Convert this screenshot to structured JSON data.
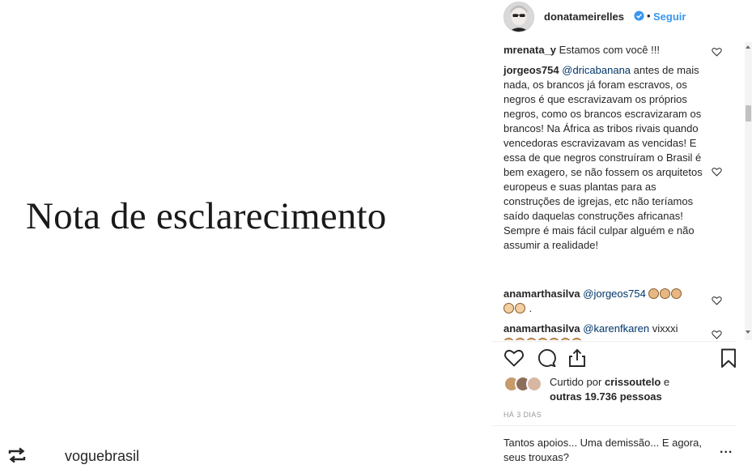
{
  "media": {
    "title": "Nota de esclarecimento",
    "repost_user": "voguebrasil"
  },
  "header": {
    "username": "donatameirelles",
    "separator": "•",
    "follow_label": "Seguir"
  },
  "comments": [
    {
      "user": "mrenata_y",
      "text": "Estamos com você !!!"
    },
    {
      "user": "jorgeos754",
      "mention": "@dricabanana",
      "text": "antes de mais nada, os brancos já foram escravos, os negros é que escravizavam os próprios negros, como os brancos escravizaram os brancos! Na África as tribos rivais quando vencedoras escravizavam as vencidas! E essa de que negros construíram o Brasil é bem exagero, se não fossem os arquitetos europeus e suas plantas para as construções de igrejas, etc não teríamos saído daquelas construções africanas! Sempre é mais fácil culpar alguém e não assumir a realidade!"
    },
    {
      "user": "anamarthasilva",
      "mention": "@jorgeos754",
      "text": "."
    },
    {
      "user": "anamarthasilva",
      "mention": "@karenfkaren",
      "text": "vixxxi"
    }
  ],
  "likes": {
    "prefix": "Curtido por",
    "user": "crissoutelo",
    "conj": "e",
    "others": "outras 19.736 pessoas"
  },
  "date": "HÁ 3 DIAS",
  "add_comment": "Tantos apoios... Uma demissão... E agora, seus trouxas?",
  "more_label": "...",
  "icons": {
    "repost": "repost-icon",
    "verified": "verified-badge-icon",
    "like": "heart-outline-icon",
    "comment": "comment-bubble-icon",
    "share": "share-icon",
    "save": "bookmark-icon",
    "comment_like": "small-heart-icon"
  },
  "colors": {
    "link_blue": "#3897f0",
    "mention_blue": "#003569",
    "muted": "#999999"
  }
}
